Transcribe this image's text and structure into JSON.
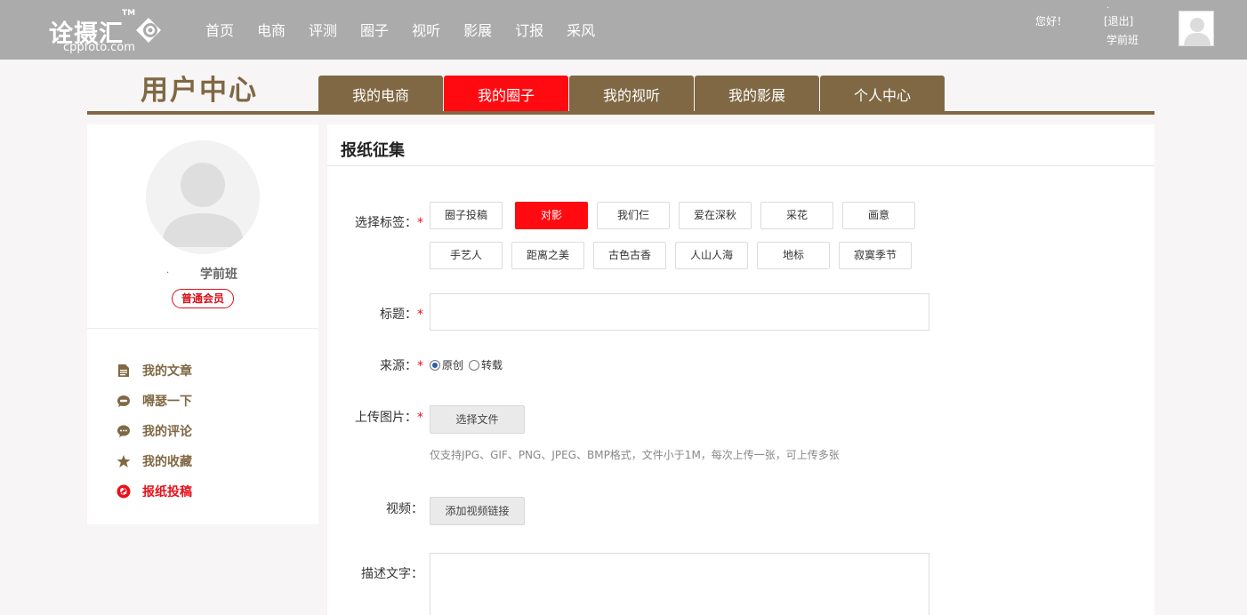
{
  "header": {
    "logo_text": "诠摄汇",
    "logo_tm": "TM",
    "logo_sub": "cppfoto.com",
    "nav": [
      "首页",
      "电商",
      "评测",
      "圈子",
      "视听",
      "影展",
      "订报",
      "采风"
    ],
    "greeting": "您好！",
    "logout": "[退出]",
    "username": "学前班"
  },
  "user_center": {
    "title": "用户中心",
    "tabs": [
      "我的电商",
      "我的圈子",
      "我的视听",
      "我的影展",
      "个人中心"
    ],
    "active_tab": 1
  },
  "sidebar": {
    "username": "学前班",
    "badge": "普通会员",
    "menu": [
      {
        "label": "我的文章",
        "icon": "document-icon"
      },
      {
        "label": "嘚瑟一下",
        "icon": "chat-bubble-icon"
      },
      {
        "label": "我的评论",
        "icon": "comment-icon"
      },
      {
        "label": "我的收藏",
        "icon": "star-icon"
      },
      {
        "label": "报纸投稿",
        "icon": "aperture-icon"
      }
    ],
    "active_index": 4
  },
  "form": {
    "section_title": "报纸征集",
    "tags_label": "选择标签：",
    "tags_row1": [
      "圈子投稿",
      "对影",
      "我们仨",
      "爱在深秋",
      "采花",
      "画意"
    ],
    "tags_row2": [
      "手艺人",
      "距离之美",
      "古色古香",
      "人山人海",
      "地标",
      "寂寞季节"
    ],
    "selected_tag": "对影",
    "title_label": "标题：",
    "title_value": "",
    "source_label": "来源：",
    "source_options": [
      "原创",
      "转载"
    ],
    "source_selected": "原创",
    "upload_label": "上传图片：",
    "upload_button": "选择文件",
    "upload_hint": "仅支持JPG、GIF、PNG、JPEG、BMP格式，文件小于1M，每次上传一张，可上传多张",
    "video_label": "视频：",
    "video_button": "添加视频链接",
    "desc_label": "描述文字：",
    "desc_value": ""
  },
  "colors": {
    "header_bg": "#ababab",
    "brown": "#7f6843",
    "red": "#ff0a10"
  }
}
